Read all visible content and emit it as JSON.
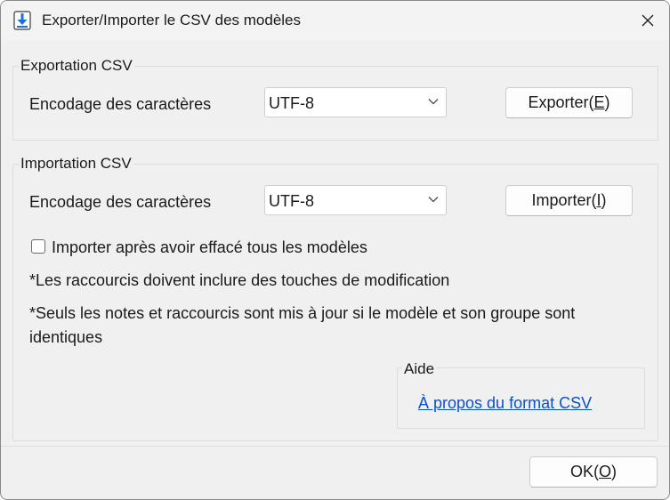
{
  "window": {
    "title": "Exporter/Importer le CSV des modèles"
  },
  "export": {
    "group_label": "Exportation CSV",
    "encoding_label": "Encodage des caractères",
    "encoding_value": "UTF-8",
    "button_label": "Exporter(",
    "button_mnemonic": "E",
    "button_suffix": ")"
  },
  "import": {
    "group_label": "Importation CSV",
    "encoding_label": "Encodage des caractères",
    "encoding_value": "UTF-8",
    "button_label": "Importer(",
    "button_mnemonic": "I",
    "button_suffix": ")",
    "checkbox_label": "Importer après avoir effacé tous les modèles",
    "checkbox_checked": false,
    "note1": "*Les raccourcis doivent inclure des touches de modification",
    "note2_line1": "*Seuls les notes et raccourcis sont mis à jour si le modèle et son groupe sont",
    "note2_line2": "identiques"
  },
  "help": {
    "group_label": "Aide",
    "link_text": "À propos du format CSV"
  },
  "footer": {
    "ok_label": "OK(",
    "ok_mnemonic": "O",
    "ok_suffix": ")"
  },
  "colors": {
    "link": "#0a50d0",
    "icon_blue": "#1e6fd9"
  },
  "icons": {
    "app": "download-arrow-icon",
    "close": "close-icon",
    "dropdown": "chevron-down-icon"
  }
}
